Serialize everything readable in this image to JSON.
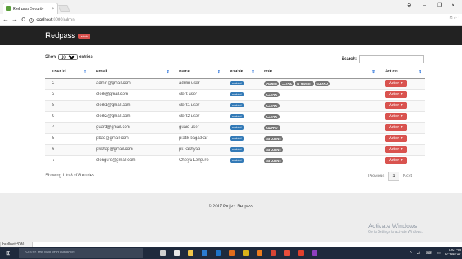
{
  "browser": {
    "tab_title": "Red pass Security",
    "tab_close": "×",
    "url_host": "localhost",
    "url_path": ":8080/admin",
    "url_info": "i",
    "back": "←",
    "forward": "→",
    "reload": "C",
    "addr_icons": "⚿ ☆ ⋮",
    "win_user": "⊖",
    "win_min": "–",
    "win_max": "❐",
    "win_close": "×"
  },
  "app": {
    "brand": "Redpass",
    "badge": "admin"
  },
  "controls": {
    "show_label": "Show",
    "show_value": "10",
    "entries_label": "entries",
    "search_label": "Search:"
  },
  "table": {
    "sort_icon": "⇕",
    "headers": [
      "user id",
      "email",
      "name",
      "enable",
      "role",
      "Action"
    ],
    "rows": [
      {
        "id": "2",
        "email": "admin@gmail.com",
        "name": "admin user",
        "enable": "enabled",
        "roles": [
          "ADMIN",
          "CLERK",
          "STUDENT",
          "GUARD"
        ],
        "action": "Action ▾"
      },
      {
        "id": "3",
        "email": "clerk@gmail.com",
        "name": "clerk user",
        "enable": "enabled",
        "roles": [
          "CLERK"
        ],
        "action": "Action ▾"
      },
      {
        "id": "8",
        "email": "clerk1@gmail.com",
        "name": "clerk1 user",
        "enable": "enabled",
        "roles": [
          "CLERK"
        ],
        "action": "Action ▾"
      },
      {
        "id": "9",
        "email": "clerk2@gmail.com",
        "name": "clerk2 user",
        "enable": "enabled",
        "roles": [
          "CLERK"
        ],
        "action": "Action ▾"
      },
      {
        "id": "4",
        "email": "guard@gmail.com",
        "name": "guard user",
        "enable": "enabled",
        "roles": [
          "GUARD"
        ],
        "action": "Action ▾"
      },
      {
        "id": "5",
        "email": "pbad@gmail.com",
        "name": "pratik bagadkar",
        "enable": "enabled",
        "roles": [
          "STUDENT"
        ],
        "action": "Action ▾"
      },
      {
        "id": "6",
        "email": "pkshap@gmail.com",
        "name": "pk kashyap",
        "enable": "enabled",
        "roles": [
          "STUDENT"
        ],
        "action": "Action ▾"
      },
      {
        "id": "7",
        "email": "clengure@gmail.com",
        "name": "Chetya Lengure",
        "enable": "enabled",
        "roles": [
          "STUDENT"
        ],
        "action": "Action ▾"
      }
    ]
  },
  "pagination": {
    "info": "Showing 1 to 8 of 8 entries",
    "previous": "Previous",
    "current": "1",
    "next": "Next"
  },
  "footer": {
    "copyright": "© 2017 Project Redpass"
  },
  "watermark": {
    "title": "Activate Windows",
    "subtitle": "Go to Settings to activate Windows."
  },
  "status_url": "localhost:8080",
  "taskbar": {
    "start_icon": "⊞",
    "search_placeholder": "Search the web and Windows",
    "tray": "^ ⊿ ⌨ ▭",
    "time": "7:03 PM",
    "date": "07-Mar-17",
    "app_colors": [
      "#d0d0d0",
      "#e8e8e8",
      "#f0c54a",
      "#2b7bd0",
      "#1e74c9",
      "#e06c1c",
      "#d8b21a",
      "#ec7b1d",
      "#d74434",
      "#ea4d3b",
      "#e0402d",
      "#8e3fbf"
    ]
  },
  "colors": {
    "header_bg": "#222222",
    "danger": "#d9534f",
    "primary": "#337ab7",
    "role_label": "#777777"
  }
}
